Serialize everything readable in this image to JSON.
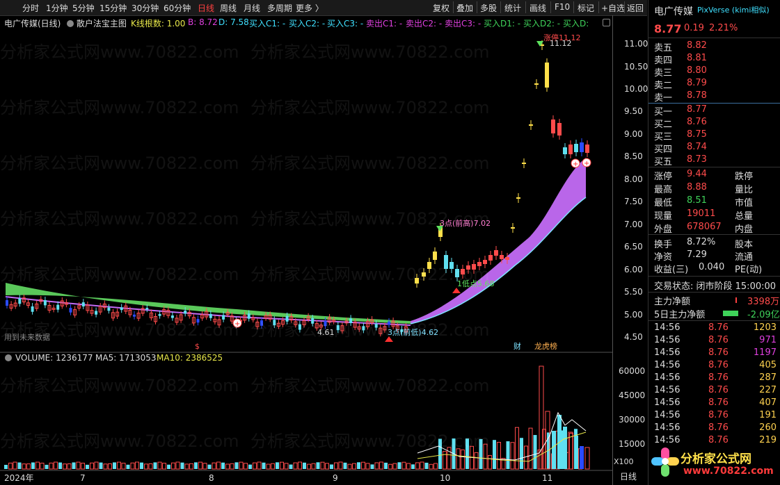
{
  "toolbar": {
    "tabs": [
      "分时",
      "1分钟",
      "5分钟",
      "15分钟",
      "30分钟",
      "60分钟",
      "日线",
      "周线",
      "月线",
      "多周期",
      "更多 〉"
    ],
    "active_tab": "日线",
    "buttons": [
      "复权",
      "叠加",
      "多股",
      "统计",
      "画线",
      "F10",
      "标记",
      "+自选",
      "返回"
    ]
  },
  "legend": {
    "title": "电广传媒(日线)",
    "indicator": "散户法宝主图",
    "k_count_label": "K线根数: 1.00",
    "b_label": "B: 8.72",
    "d_label": "D: 7.58",
    "buy_c1": "买入C1: -",
    "buy_c2": "买入C2: -",
    "buy_c3": "买入C3: -",
    "sell_c1": "卖出C1: -",
    "sell_c2": "卖出C2: -",
    "sell_c3": "卖出C3: -",
    "buy_d1": "买入D1: -",
    "buy_d2": "买入D2: -",
    "buy_d3": "买入D:"
  },
  "annotations": {
    "limit_up": "涨停11.12",
    "high_price": "11.12",
    "prev_high": "3点(前高)7.02",
    "lowpoint": "1低点5.68",
    "prev_low": "3点(前低)4.62",
    "low_price": "4.61",
    "future_data": "用到未来数据",
    "fin_tag": "财",
    "rank_tag": "龙虎榜",
    "dollar_tag": "$"
  },
  "price_axis": [
    "11.00",
    "10.50",
    "10.00",
    "9.50",
    "9.00",
    "8.50",
    "8.00",
    "7.50",
    "7.00",
    "6.50",
    "6.00",
    "5.50",
    "5.00",
    "4.50"
  ],
  "volume_legend": {
    "volume": "VOLUME: 1236177",
    "ma5": "MA5: 1713053",
    "ma10": "MA10: 2386525"
  },
  "volume_axis": [
    "60000",
    "45000",
    "30000",
    "15000"
  ],
  "volume_unit": "X100",
  "date_axis": [
    "2024年",
    "7",
    "8",
    "9",
    "10",
    "11"
  ],
  "date_axis_right": "日线",
  "quote": {
    "name": "电广传媒",
    "tag": "PixVerse (kimi相似)",
    "price": "8.77",
    "change": "0.19",
    "pct": "2.21%",
    "asks": [
      {
        "label": "卖五",
        "price": "8.82"
      },
      {
        "label": "卖四",
        "price": "8.81"
      },
      {
        "label": "卖三",
        "price": "8.80"
      },
      {
        "label": "卖二",
        "price": "8.79"
      },
      {
        "label": "卖一",
        "price": "8.78"
      }
    ],
    "bids": [
      {
        "label": "买一",
        "price": "8.77"
      },
      {
        "label": "买二",
        "price": "8.76"
      },
      {
        "label": "买三",
        "price": "8.75"
      },
      {
        "label": "买四",
        "price": "8.74"
      },
      {
        "label": "买五",
        "price": "8.73"
      }
    ],
    "stats": [
      {
        "l1": "涨停",
        "v1": "9.44",
        "l2": "跌停"
      },
      {
        "l1": "最高",
        "v1": "8.88",
        "l2": "量比"
      },
      {
        "l1": "最低",
        "v1": "8.51",
        "l2": "市值"
      },
      {
        "l1": "现量",
        "v1": "19011",
        "l2": "总量"
      },
      {
        "l1": "外盘",
        "v1": "678067",
        "l2": "内盘"
      }
    ],
    "stats2": [
      {
        "l1": "换手",
        "v1": "8.72%",
        "l2": "股本"
      },
      {
        "l1": "净资",
        "v1": "7.29",
        "l2": "流通"
      },
      {
        "l1": "收益(三)",
        "v1": "0.040",
        "l2": "PE(动)"
      }
    ],
    "trade_status": "交易状态: 闭市阶段 15:00:00",
    "main_flow_label": "主力净额",
    "main_flow_value": "3398万",
    "flow5_label": "5日主力净额",
    "flow5_value": "-2.09亿",
    "ticks": [
      {
        "t": "14:56",
        "p": "8.76",
        "v": "1203"
      },
      {
        "t": "14:56",
        "p": "8.76",
        "v": "971"
      },
      {
        "t": "14:56",
        "p": "8.76",
        "v": "1197"
      },
      {
        "t": "14:56",
        "p": "8.76",
        "v": "405"
      },
      {
        "t": "14:56",
        "p": "8.76",
        "v": "287"
      },
      {
        "t": "14:56",
        "p": "8.76",
        "v": "227"
      },
      {
        "t": "14:56",
        "p": "8.76",
        "v": "407"
      },
      {
        "t": "14:56",
        "p": "8.76",
        "v": "191"
      },
      {
        "t": "14:56",
        "p": "8.76",
        "v": "260"
      },
      {
        "t": "14:56",
        "p": "8.76",
        "v": "219"
      }
    ]
  },
  "watermark": "分析家公式网www.70822.com",
  "logo": {
    "text": "分析家公式网",
    "url": "www.70822.com"
  }
}
